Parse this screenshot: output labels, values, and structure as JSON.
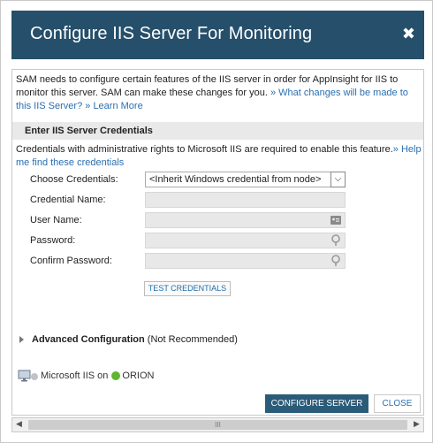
{
  "dialog": {
    "title": "Configure IIS Server For Monitoring",
    "close_glyph": "✖"
  },
  "intro": {
    "text": "SAM needs to configure certain features of the IIS server in order for AppInsight for IIS to monitor this server. SAM can make these changes for you.",
    "changes_link": "» What changes will be made to this IIS Server?",
    "learn_more_link": "» Learn More"
  },
  "credentials": {
    "section_title": "Enter IIS Server Credentials",
    "note": "Credentials with administrative rights to Microsoft IIS are required to enable this feature.",
    "help_link": "» Help me find these credentials",
    "choose_label": "Choose Credentials:",
    "choose_value": "<Inherit Windows credential from node>",
    "name_label": "Credential Name:",
    "user_label": "User Name:",
    "password_label": "Password:",
    "confirm_label": "Confirm Password:",
    "test_button": "TEST CREDENTIALS"
  },
  "advanced": {
    "label": "Advanced Configuration",
    "note": "(Not Recommended)"
  },
  "monitor": {
    "app": "Microsoft IIS on",
    "node": "ORION",
    "node_status_color": "#5fb52f"
  },
  "footer": {
    "configure_button": "CONFIGURE SERVER",
    "close_button": "CLOSE"
  },
  "scrollbar": {
    "left_glyph": "◀",
    "right_glyph": "▶",
    "grip": "III"
  },
  "colors": {
    "titlebar": "#254f6a",
    "primary_button": "#2a5c79",
    "link": "#2a6fb0"
  },
  "icons": [
    "close-icon",
    "chevron-down-icon",
    "id-card-icon",
    "key-icon",
    "expand-triangle-icon",
    "monitor-icon",
    "status-dot-icon"
  ]
}
